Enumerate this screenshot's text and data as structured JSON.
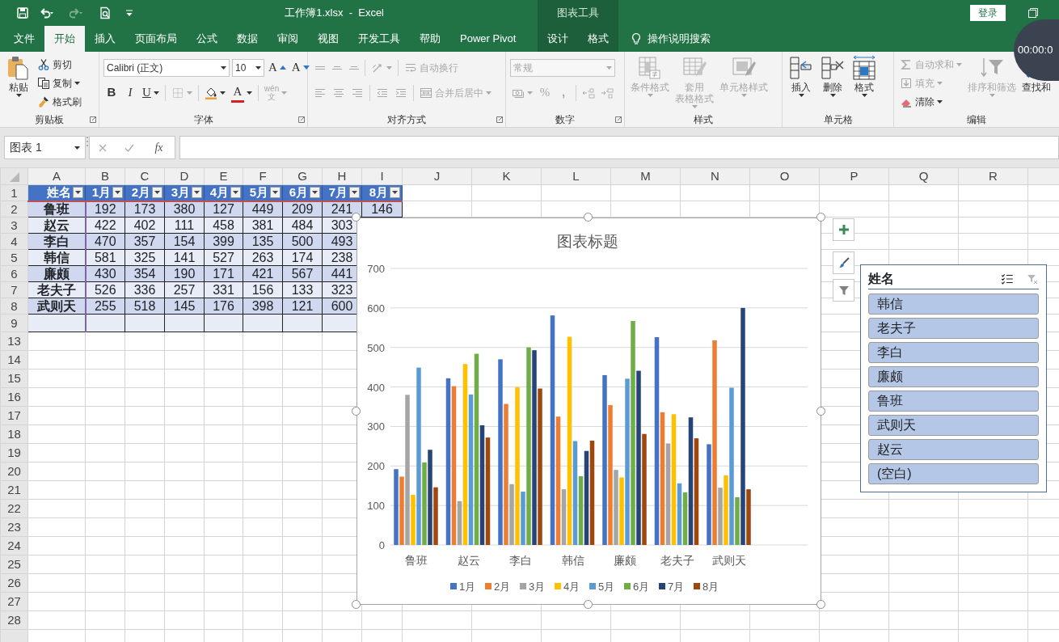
{
  "title_bar": {
    "quick_access": [
      {
        "disabled": false
      },
      {
        "disabled": false
      },
      {
        "disabled": true
      },
      {
        "disabled": false
      },
      {
        "disabled": false
      }
    ],
    "title": "工作簿1.xlsx  -  Excel",
    "context_label": "图表工具",
    "login": "登录"
  },
  "tabs": [
    {
      "label": "文件",
      "selected": false,
      "context": false
    },
    {
      "label": "开始",
      "selected": true,
      "context": false
    },
    {
      "label": "插入",
      "selected": false,
      "context": false
    },
    {
      "label": "页面布局",
      "selected": false,
      "context": false
    },
    {
      "label": "公式",
      "selected": false,
      "context": false
    },
    {
      "label": "数据",
      "selected": false,
      "context": false
    },
    {
      "label": "审阅",
      "selected": false,
      "context": false
    },
    {
      "label": "视图",
      "selected": false,
      "context": false
    },
    {
      "label": "开发工具",
      "selected": false,
      "context": false
    },
    {
      "label": "帮助",
      "selected": false,
      "context": false
    },
    {
      "label": "Power Pivot",
      "selected": false,
      "context": false
    },
    {
      "label": "设计",
      "selected": false,
      "context": true
    },
    {
      "label": "格式",
      "selected": false,
      "context": true
    }
  ],
  "tell_me": "操作说明搜索",
  "timer": "00:00:0",
  "ribbon": [
    {
      "label": "剪贴板",
      "launcher": true,
      "stacks": [
        {
          "kind": "large",
          "label": "粘贴",
          "caret": true,
          "disabled": false
        },
        {
          "kind": "rows",
          "rows": [
            {
              "items": [
                {
                  "kind": "small",
                  "label": "剪切",
                  "caret": false,
                  "disabled": false
                }
              ]
            },
            {
              "items": [
                {
                  "kind": "small",
                  "label": "复制",
                  "caret": true,
                  "disabled": false
                }
              ]
            },
            {
              "items": [
                {
                  "kind": "small",
                  "label": "格式刷",
                  "caret": false,
                  "disabled": false
                }
              ]
            }
          ]
        }
      ]
    },
    {
      "label": "字体",
      "launcher": true,
      "stacks": [
        {
          "kind": "rows",
          "rows": [
            {
              "items": [
                {
                  "kind": "select",
                  "value": "Calibri (正文)",
                  "disabled": false
                },
                {
                  "kind": "select",
                  "value": "10",
                  "disabled": false
                },
                {
                  "kind": "char",
                  "label": "A",
                  "caret": false,
                  "disabled": false
                },
                {
                  "kind": "char",
                  "label": "A",
                  "caret": false,
                  "disabled": false
                }
              ]
            },
            {
              "items": [
                {
                  "kind": "char",
                  "label": "B",
                  "caret": false,
                  "disabled": false
                },
                {
                  "kind": "char",
                  "label": "I",
                  "caret": false,
                  "disabled": false
                },
                {
                  "kind": "char",
                  "label": "U",
                  "caret": true,
                  "disabled": false
                },
                {
                  "kind": "sep"
                },
                {
                  "kind": "icon",
                  "caret": true,
                  "disabled": true
                },
                {
                  "kind": "sep"
                },
                {
                  "kind": "icon",
                  "caret": true,
                  "disabled": false
                },
                {
                  "kind": "char",
                  "label": "A",
                  "caret": true,
                  "disabled": false
                },
                {
                  "kind": "sep"
                },
                {
                  "kind": "char",
                  "label": "wén",
                  "label_2": "文",
                  "caret": true,
                  "disabled": true
                }
              ]
            }
          ]
        }
      ]
    },
    {
      "label": "对齐方式",
      "launcher": true,
      "stacks": [
        {
          "kind": "rows",
          "rows": [
            {
              "items": [
                {
                  "kind": "icon",
                  "caret": false,
                  "disabled": true
                },
                {
                  "kind": "icon",
                  "caret": false,
                  "disabled": true
                },
                {
                  "kind": "icon",
                  "caret": false,
                  "disabled": true
                },
                {
                  "kind": "sep"
                },
                {
                  "kind": "icon",
                  "caret": true,
                  "disabled": true
                },
                {
                  "kind": "sep"
                },
                {
                  "kind": "small",
                  "label": "自动换行",
                  "caret": false,
                  "disabled": true
                }
              ]
            },
            {
              "items": [
                {
                  "kind": "icon",
                  "caret": false,
                  "disabled": true
                },
                {
                  "kind": "icon",
                  "caret": false,
                  "disabled": true
                },
                {
                  "kind": "icon",
                  "caret": false,
                  "disabled": true
                },
                {
                  "kind": "sep"
                },
                {
                  "kind": "icon",
                  "caret": false,
                  "disabled": true
                },
                {
                  "kind": "icon",
                  "caret": false,
                  "disabled": true
                },
                {
                  "kind": "sep"
                },
                {
                  "kind": "small",
                  "label": "合并后居中",
                  "caret": true,
                  "disabled": true
                }
              ]
            }
          ]
        }
      ]
    },
    {
      "label": "数字",
      "launcher": true,
      "stacks": [
        {
          "kind": "rows",
          "rows": [
            {
              "items": [
                {
                  "kind": "select",
                  "value": "常规",
                  "disabled": true
                }
              ]
            },
            {
              "items": [
                {
                  "kind": "icon",
                  "caret": true,
                  "disabled": true
                },
                {
                  "kind": "char",
                  "label": "%",
                  "caret": false,
                  "disabled": true
                },
                {
                  "kind": "char",
                  "label": ",",
                  "caret": false,
                  "disabled": true
                },
                {
                  "kind": "sep"
                },
                {
                  "kind": "icon",
                  "caret": false,
                  "disabled": true
                },
                {
                  "kind": "icon",
                  "caret": false,
                  "disabled": true
                }
              ]
            }
          ]
        }
      ]
    },
    {
      "label": "样式",
      "launcher": false,
      "stacks": [
        {
          "kind": "large",
          "label": "条件格式",
          "caret": true,
          "disabled": true
        },
        {
          "kind": "large",
          "label": "套用",
          "label_2": "表格格式",
          "caret": true,
          "disabled": true
        },
        {
          "kind": "large",
          "label": "单元格样式",
          "caret": true,
          "disabled": true
        }
      ]
    },
    {
      "label": "单元格",
      "launcher": false,
      "stacks": [
        {
          "kind": "large",
          "label": "插入",
          "caret": true,
          "disabled": false
        },
        {
          "kind": "large",
          "label": "删除",
          "caret": true,
          "disabled": false
        },
        {
          "kind": "large",
          "label": "格式",
          "caret": true,
          "disabled": false
        }
      ]
    },
    {
      "label": "编辑",
      "launcher": false,
      "stacks": [
        {
          "kind": "rows",
          "rows": [
            {
              "items": [
                {
                  "kind": "small",
                  "label": "自动求和",
                  "caret": true,
                  "disabled": true
                }
              ]
            },
            {
              "items": [
                {
                  "kind": "small",
                  "label": "填充",
                  "caret": true,
                  "disabled": true
                }
              ]
            },
            {
              "items": [
                {
                  "kind": "small",
                  "label": "清除",
                  "caret": true,
                  "disabled": false
                }
              ]
            }
          ]
        },
        {
          "kind": "large",
          "label": "排序和筛选",
          "caret": true,
          "disabled": true
        },
        {
          "kind": "large",
          "label": "查找和",
          "caret": false,
          "disabled": false
        }
      ]
    }
  ],
  "formula_bar": {
    "name_box": "图表 1",
    "fx": "fx"
  },
  "sheet": {
    "columns": [
      "A",
      "B",
      "C",
      "D",
      "E",
      "F",
      "G",
      "H",
      "I",
      "J",
      "K",
      "L",
      "M",
      "N",
      "O",
      "P",
      "Q",
      "R"
    ],
    "row_numbers": [
      "1",
      "2",
      "3",
      "4",
      "5",
      "6",
      "7",
      "8",
      "9",
      "13",
      "14",
      "15",
      "16",
      "17",
      "18",
      "19",
      "20",
      "21",
      "22",
      "23",
      "24",
      "25",
      "26",
      "27",
      "28"
    ],
    "table": {
      "header": [
        "姓名",
        "1月",
        "2月",
        "3月",
        "4月",
        "5月",
        "6月",
        "7月",
        "8月"
      ],
      "rows": [
        [
          "鲁班",
          "192",
          "173",
          "380",
          "127",
          "449",
          "209",
          "241",
          "146"
        ],
        [
          "赵云",
          "422",
          "402",
          "111",
          "458",
          "381",
          "484",
          "303"
        ],
        [
          "李白",
          "470",
          "357",
          "154",
          "399",
          "135",
          "500",
          "493"
        ],
        [
          "韩信",
          "581",
          "325",
          "141",
          "527",
          "263",
          "174",
          "238"
        ],
        [
          "廉颇",
          "430",
          "354",
          "190",
          "171",
          "421",
          "567",
          "441"
        ],
        [
          "老夫子",
          "526",
          "336",
          "257",
          "331",
          "156",
          "133",
          "323"
        ],
        [
          "武则天",
          "255",
          "518",
          "145",
          "176",
          "398",
          "121",
          "600"
        ]
      ]
    }
  },
  "chart": {
    "chart_data": {
      "type": "bar",
      "title": "图表标题",
      "grid": true,
      "legend": "bottom",
      "categories": [
        "鲁班",
        "赵云",
        "李白",
        "韩信",
        "廉颇",
        "老夫子",
        "武则天"
      ],
      "ylim": [
        0,
        700
      ],
      "yticks": [
        0,
        100,
        200,
        300,
        400,
        500,
        600,
        700
      ],
      "series": [
        {
          "name": "1月",
          "color": "#4472c4",
          "values": [
            192,
            422,
            470,
            581,
            430,
            526,
            255
          ]
        },
        {
          "name": "2月",
          "color": "#ed7d31",
          "values": [
            173,
            402,
            357,
            325,
            354,
            336,
            518
          ]
        },
        {
          "name": "3月",
          "color": "#a5a5a5",
          "values": [
            380,
            111,
            154,
            141,
            190,
            257,
            145
          ]
        },
        {
          "name": "4月",
          "color": "#ffc000",
          "values": [
            127,
            458,
            399,
            527,
            171,
            331,
            176
          ]
        },
        {
          "name": "5月",
          "color": "#5b9bd5",
          "values": [
            449,
            381,
            135,
            263,
            421,
            156,
            398
          ]
        },
        {
          "name": "6月",
          "color": "#70ad47",
          "values": [
            209,
            484,
            500,
            174,
            567,
            133,
            121
          ]
        },
        {
          "name": "7月",
          "color": "#264478",
          "values": [
            241,
            303,
            493,
            238,
            441,
            323,
            600
          ]
        },
        {
          "name": "8月",
          "color": "#9e480e",
          "values": [
            146,
            272,
            396,
            264,
            281,
            270,
            141
          ]
        }
      ]
    }
  },
  "slicer": {
    "title": "姓名",
    "clear_filter_disabled": true,
    "items": [
      {
        "label": "韩信",
        "selected": true
      },
      {
        "label": "老夫子",
        "selected": true
      },
      {
        "label": "李白",
        "selected": true
      },
      {
        "label": "廉颇",
        "selected": true
      },
      {
        "label": "鲁班",
        "selected": true
      },
      {
        "label": "武则天",
        "selected": true
      },
      {
        "label": "赵云",
        "selected": true
      },
      {
        "label": "(空白)",
        "selected": true
      }
    ]
  }
}
